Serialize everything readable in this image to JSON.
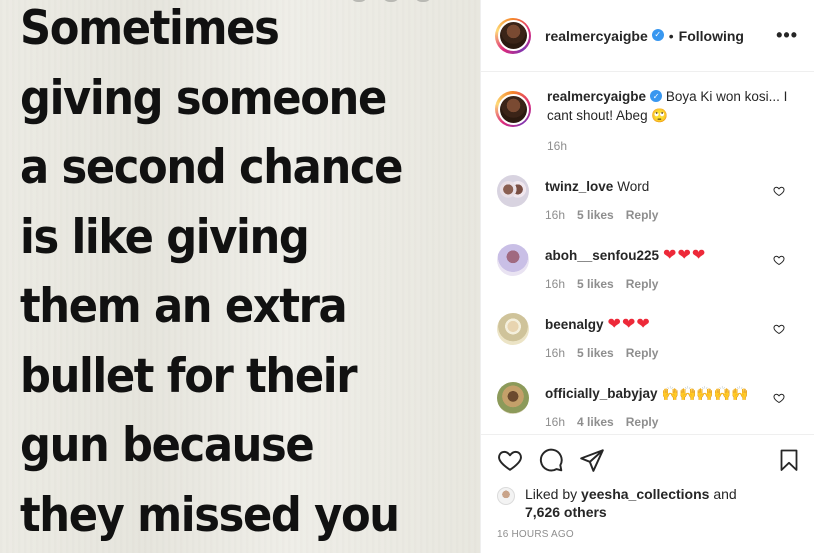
{
  "post_image": {
    "quote_lines": [
      "Sometimes",
      "giving someone",
      "a second chance",
      "is like giving",
      "them an extra",
      "bullet for their",
      "gun because",
      "they missed you"
    ]
  },
  "header": {
    "username": "realmercyaigbe",
    "separator": "•",
    "follow_status": "Following",
    "more_icon": "•••"
  },
  "caption": {
    "username": "realmercyaigbe",
    "text": "Boya Ki won kosi... I cant shout! Abeg 🙄",
    "time": "16h"
  },
  "comments": [
    {
      "username": "twinz_love",
      "text": "Word",
      "time": "16h",
      "likes": "5 likes",
      "reply": "Reply"
    },
    {
      "username": "aboh__senfou225",
      "text": "❤❤❤",
      "time": "16h",
      "likes": "5 likes",
      "reply": "Reply"
    },
    {
      "username": "beenalgy",
      "text": "❤❤❤",
      "time": "16h",
      "likes": "5 likes",
      "reply": "Reply"
    },
    {
      "username": "officially_babyjay",
      "text": "🙌🙌🙌🙌🙌",
      "time": "16h",
      "likes": "4 likes",
      "reply": "Reply"
    }
  ],
  "actions": {
    "liked_by_prefix": "Liked by",
    "liked_by_user": "yeesha_collections",
    "liked_by_and": "and",
    "others_count": "7,626 others",
    "timestamp": "16 HOURS AGO"
  },
  "colors": {
    "accent_blue": "#3897f0",
    "heart_red": "#ed2939",
    "muted_gray": "#8e8e8e"
  }
}
